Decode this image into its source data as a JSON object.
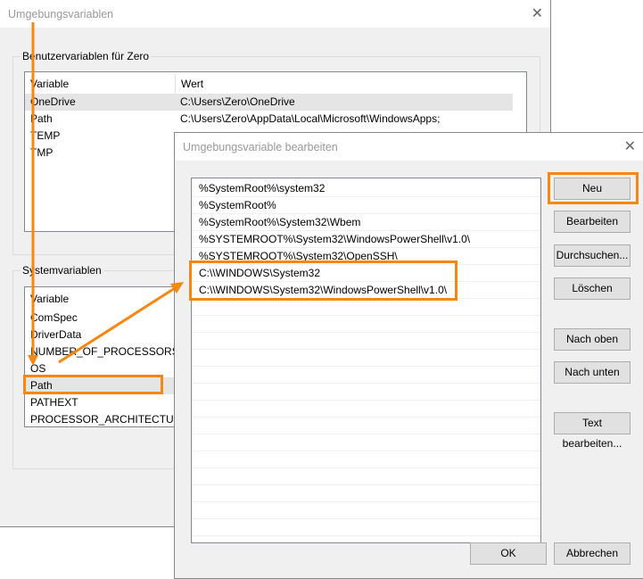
{
  "back": {
    "title": "Umgebungsvariablen",
    "user_group": "Benutzervariablen für Zero",
    "col_variable": "Variable",
    "col_value": "Wert",
    "user_vars": [
      {
        "name": "OneDrive",
        "value": "C:\\Users\\Zero\\OneDrive"
      },
      {
        "name": "Path",
        "value": "C:\\Users\\Zero\\AppData\\Local\\Microsoft\\WindowsApps;"
      },
      {
        "name": "TEMP",
        "value": ""
      },
      {
        "name": "TMP",
        "value": ""
      }
    ],
    "sys_group": "Systemvariablen",
    "sys_col_variable": "Variable",
    "sys_vars": [
      "ComSpec",
      "DriverData",
      "NUMBER_OF_PROCESSORS",
      "OS",
      "Path",
      "PATHEXT",
      "PROCESSOR_ARCHITECTURE"
    ]
  },
  "front": {
    "title": "Umgebungsvariable bearbeiten",
    "entries": [
      "%SystemRoot%\\system32",
      "%SystemRoot%",
      "%SystemRoot%\\System32\\Wbem",
      "%SYSTEMROOT%\\System32\\WindowsPowerShell\\v1.0\\",
      "%SYSTEMROOT%\\System32\\OpenSSH\\",
      "C:\\\\WINDOWS\\System32",
      "C:\\\\WINDOWS\\System32\\WindowsPowerShell\\v1.0\\"
    ],
    "buttons": {
      "new": "Neu",
      "edit": "Bearbeiten",
      "browse": "Durchsuchen...",
      "delete": "Löschen",
      "up": "Nach oben",
      "down": "Nach unten",
      "text_edit": "Text bearbeiten...",
      "ok": "OK",
      "cancel": "Abbrechen"
    }
  },
  "colors": {
    "highlight": "#f7870f"
  }
}
